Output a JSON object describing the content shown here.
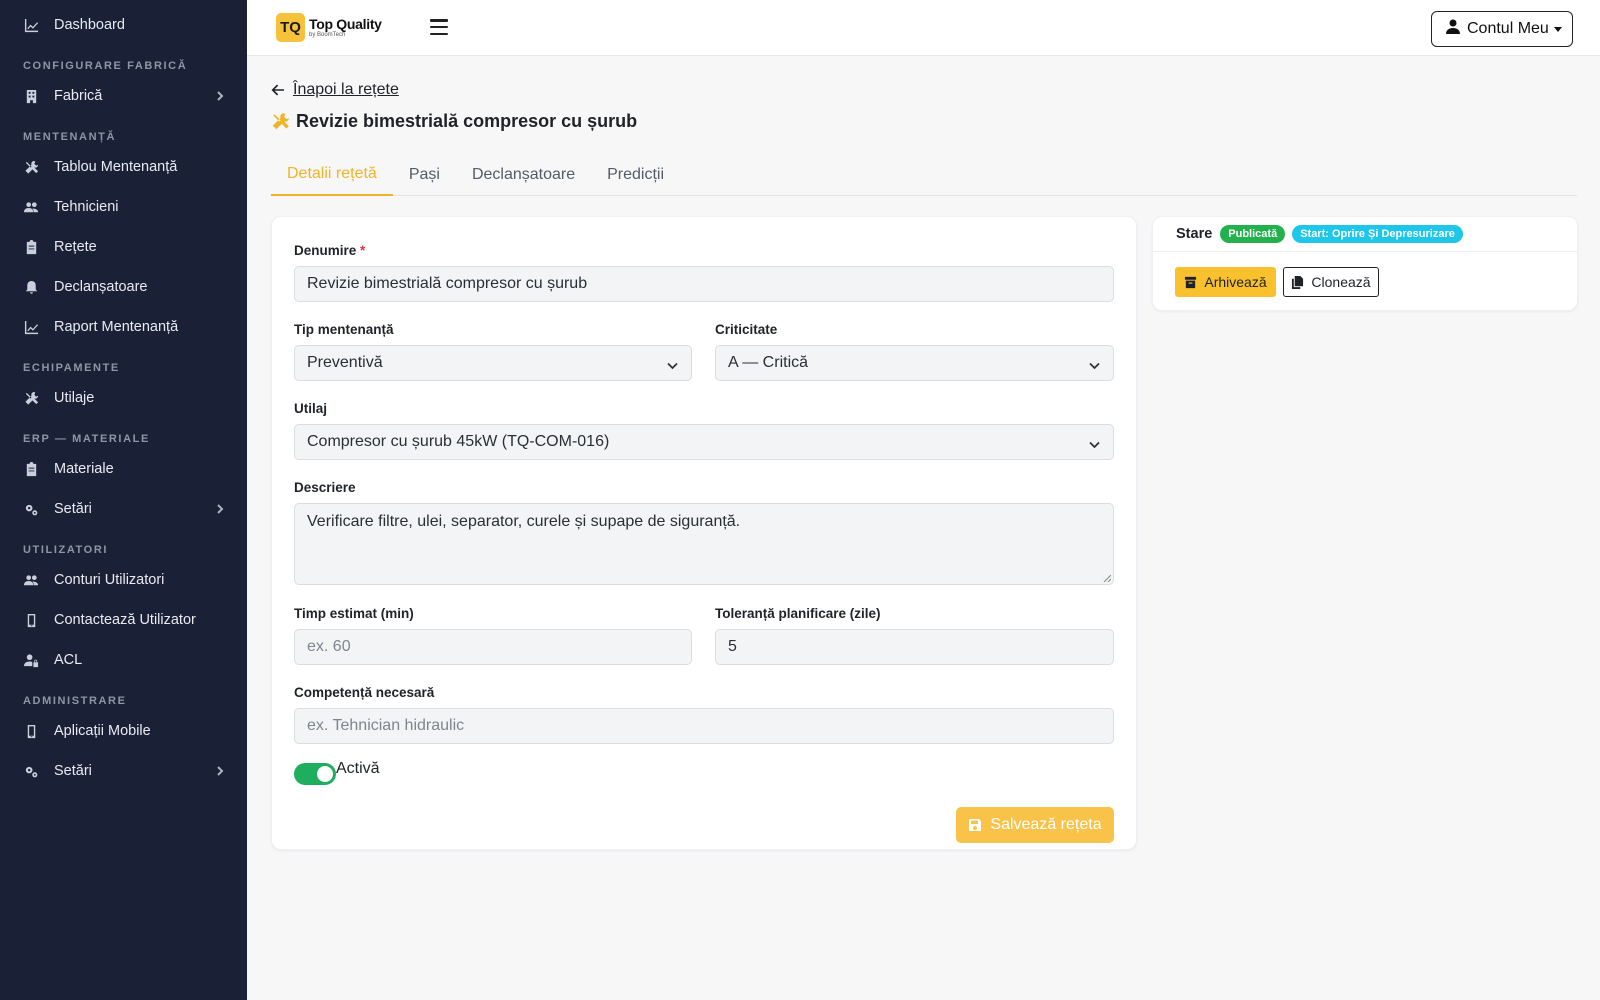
{
  "sidebar": {
    "dashboard": {
      "label": "Dashboard",
      "icon": "chart-line-icon"
    },
    "section_factory": "CONFIGURARE FABRICĂ",
    "factory": {
      "label": "Fabrică",
      "icon": "building-icon"
    },
    "section_maintenance": "MENTENANȚĂ",
    "maintenance_board": {
      "label": "Tablou Mentenanță",
      "icon": "tools-icon"
    },
    "technicians": {
      "label": "Tehnicieni",
      "icon": "users-icon"
    },
    "recipes": {
      "label": "Rețete",
      "icon": "clipboard-icon"
    },
    "triggers": {
      "label": "Declanșatoare",
      "icon": "bell-icon"
    },
    "maintenance_report": {
      "label": "Raport Mentenanță",
      "icon": "chart-line-icon"
    },
    "section_equipment": "ECHIPAMENTE",
    "machines": {
      "label": "Utilaje",
      "icon": "tools-icon"
    },
    "section_erp": "ERP — MATERIALE",
    "materials": {
      "label": "Materiale",
      "icon": "clipboard-icon"
    },
    "erp_settings": {
      "label": "Setări",
      "icon": "cogs-icon"
    },
    "section_users": "UTILIZATORI",
    "user_accounts": {
      "label": "Conturi Utilizatori",
      "icon": "users-icon"
    },
    "contact_user": {
      "label": "Contactează Utilizator",
      "icon": "mobile-icon"
    },
    "acl": {
      "label": "ACL",
      "icon": "user-lock-icon"
    },
    "section_admin": "ADMINISTRARE",
    "mobile_apps": {
      "label": "Aplicații Mobile",
      "icon": "mobile-icon"
    },
    "admin_settings": {
      "label": "Setări",
      "icon": "cogs-icon"
    }
  },
  "topbar": {
    "logo_mark": "TQ",
    "logo_title": "Top Quality",
    "logo_sub": "by BoomTech",
    "account_label": "Contul Meu"
  },
  "page": {
    "back_label": "Înapoi la rețete",
    "title": "Revizie bimestrială compresor cu șurub"
  },
  "tabs": [
    "Detalii rețetă",
    "Pași",
    "Declanșatoare",
    "Predicții"
  ],
  "form": {
    "name_label": "Denumire",
    "name_required_mark": "*",
    "name_value": "Revizie bimestrială compresor cu șurub",
    "type_label": "Tip mentenanță",
    "type_value": "Preventivă",
    "criticality_label": "Criticitate",
    "criticality_value": "A — Critică",
    "machine_label": "Utilaj",
    "machine_value": "Compresor cu șurub 45kW (TQ-COM-016)",
    "description_label": "Descriere",
    "description_value": "Verificare filtre, ulei, separator, curele și supape de siguranță.",
    "time_label": "Timp estimat (min)",
    "time_placeholder": "ex. 60",
    "tolerance_label": "Toleranță planificare (zile)",
    "tolerance_value": "5",
    "competence_label": "Competență necesară",
    "competence_placeholder": "ex. Tehnician hidraulic",
    "active_label": "Activă",
    "active_on": true,
    "save_label": "Salvează rețeta"
  },
  "status": {
    "label": "Stare",
    "badge_published": "Publicată",
    "badge_start": "Start: Oprire Și Depresurizare",
    "archive_label": "Arhivează",
    "clone_label": "Clonează"
  },
  "colors": {
    "sidebar_bg": "#1a2035",
    "accent": "#f0b429",
    "success": "#22b14c",
    "info": "#1ec6ea",
    "toggle_on": "#1fae5e"
  }
}
